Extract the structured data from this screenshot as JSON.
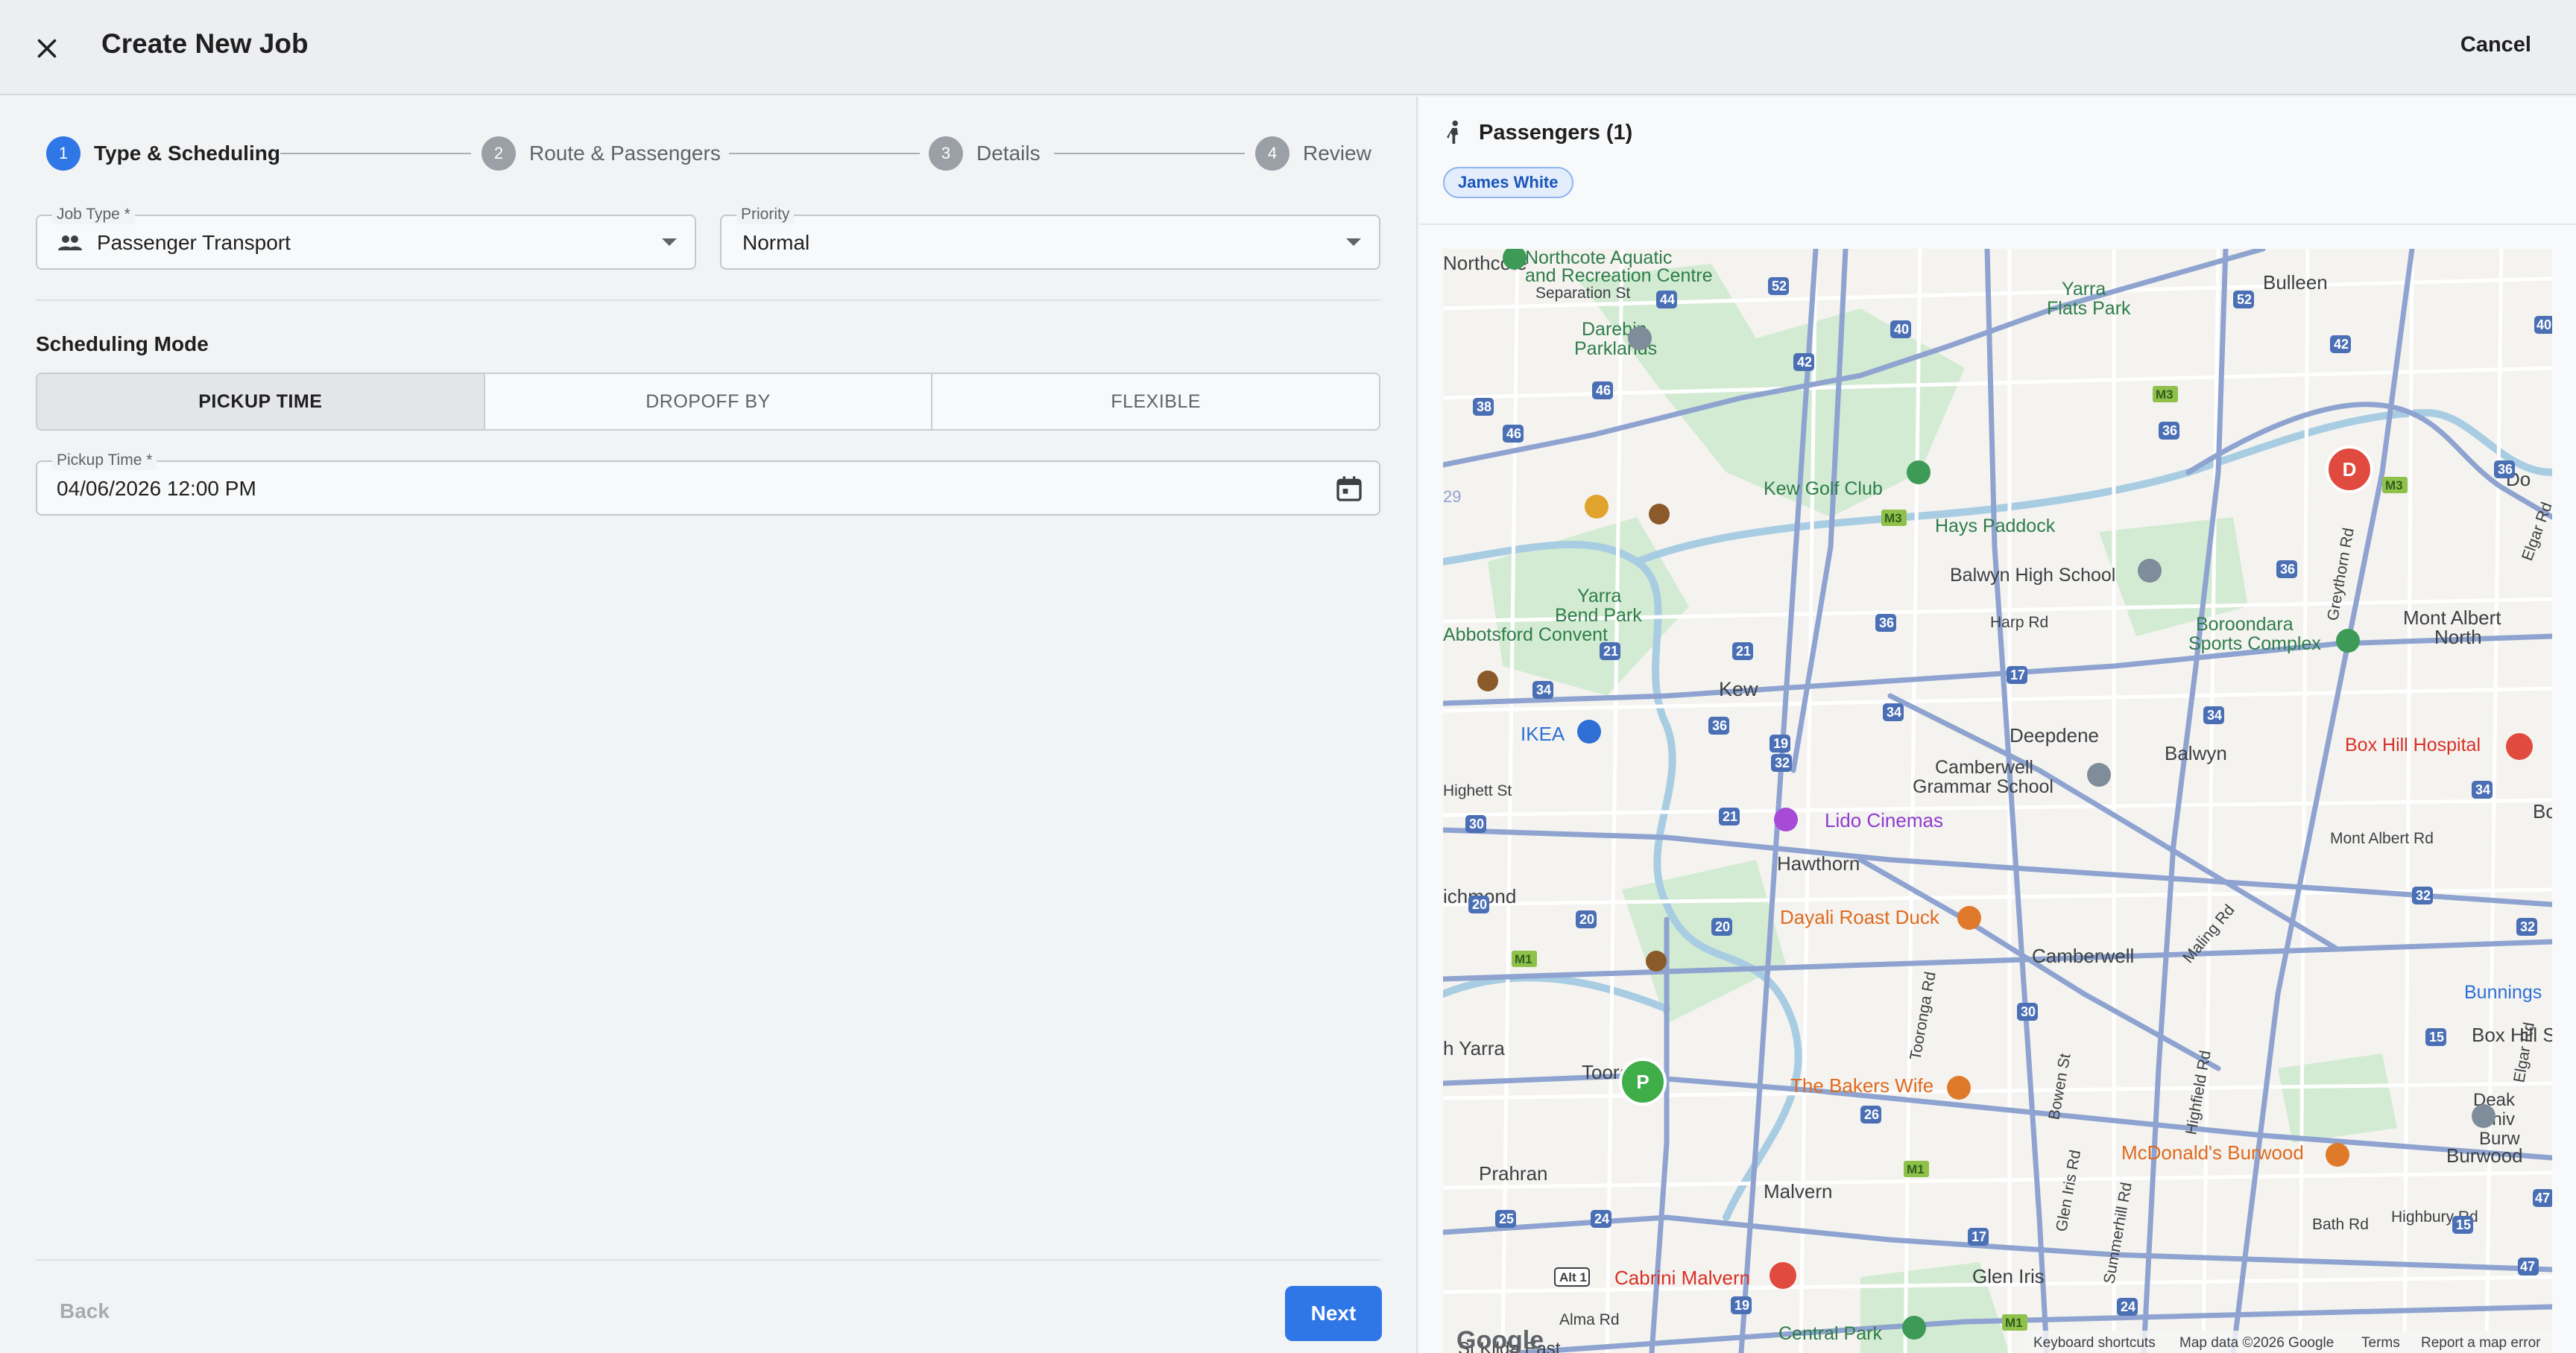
{
  "header": {
    "title": "Create New Job",
    "cancel_label": "Cancel"
  },
  "stepper": {
    "steps": [
      {
        "number": "1",
        "label": "Type & Scheduling",
        "active": true
      },
      {
        "number": "2",
        "label": "Route & Passengers",
        "active": false
      },
      {
        "number": "3",
        "label": "Details",
        "active": false
      },
      {
        "number": "4",
        "label": "Review",
        "active": false
      }
    ]
  },
  "form": {
    "job_type": {
      "label": "Job Type *",
      "value": "Passenger Transport",
      "icon": "people-icon"
    },
    "priority": {
      "label": "Priority",
      "value": "Normal"
    },
    "scheduling": {
      "title": "Scheduling Mode",
      "options": [
        "PICKUP TIME",
        "DROPOFF BY",
        "FLEXIBLE"
      ],
      "selected": "PICKUP TIME"
    },
    "pickup_time": {
      "label": "Pickup Time *",
      "value": "04/06/2026 12:00 PM",
      "icon": "calendar-icon"
    }
  },
  "footer": {
    "back_label": "Back",
    "next_label": "Next"
  },
  "passengers": {
    "title": "Passengers (1)",
    "icon": "passenger-icon",
    "chips": [
      "James White"
    ]
  },
  "map": {
    "places": [
      "Northcote Aquatic and Recreation Centre",
      "Northcote",
      "Separation St",
      "Darebin Parklands",
      "Yarra Flats Park",
      "Bulleen",
      "Kew Golf Club",
      "Hays Paddock",
      "Balwyn High School",
      "Yarra Bend Park",
      "Abbotsford Convent",
      "Harp Rd",
      "Boroondara Sports Complex",
      "Mont Albert North",
      "Greythorn Rd",
      "Kew",
      "IKEA",
      "Deepdene",
      "Balwyn",
      "Box Hill Hospital",
      "Camberwell Grammar School",
      "Highett St",
      "Lido Cinemas",
      "Hawthorn",
      "Mont Albert Rd",
      "Richmond",
      "Dayali Roast Duck",
      "Camberwell",
      "Bunnings",
      "Box Hill S",
      "h Yarra",
      "Toorak",
      "The Bakers Wife",
      "Toorong Rd",
      "Bowen St",
      "Highfield Rd",
      "Elgar Rd",
      "McDonald's Burwood",
      "Burwood",
      "Prahran",
      "Malvern",
      "Glen Iris Rd",
      "Summerhill Rd",
      "Bath Rd",
      "Highbury Rd",
      "Cabrini Malvern",
      "Glen Iris",
      "Alma Rd",
      "Central Park",
      "St Kilda East",
      "Maling Rd",
      "Deakin Univ",
      "Alt 1"
    ],
    "markers": {
      "pickup": "P",
      "dropoff": "D"
    },
    "attribution": {
      "logo": "Google",
      "shortcuts": "Keyboard shortcuts",
      "data": "Map data ©2026 Google",
      "terms": "Terms",
      "report": "Report a map error"
    },
    "colors": {
      "road_major": "#8ea3cf",
      "road_minor": "#ffffff",
      "water": "#9fc7e0",
      "park": "#cde8cf",
      "pickup": "#3fae49",
      "dropoff": "#e04a3f"
    }
  },
  "colors": {
    "accent": "#2f76e6",
    "chip_border": "#8fb4ef"
  }
}
